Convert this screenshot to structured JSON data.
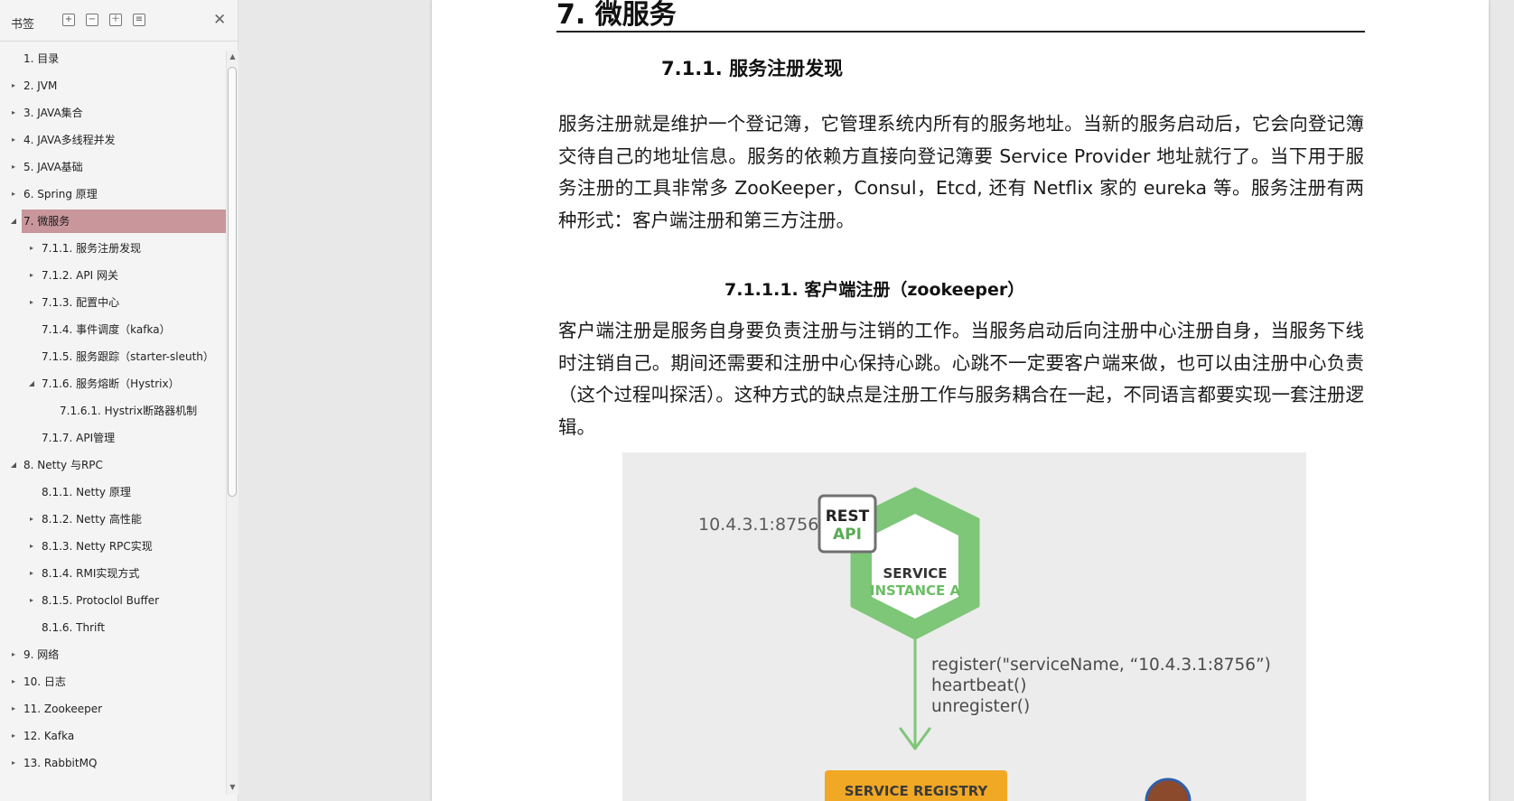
{
  "sidebar": {
    "title": "书签",
    "toolbar": {
      "expand_icon": "expand-all-icon",
      "collapse_icon": "collapse-all-icon",
      "add_icon": "add-bookmark-icon",
      "bookmark_icon": "bookmark-options-icon"
    },
    "close_label": "✕",
    "items": [
      {
        "label": "1. 目录",
        "level": 1,
        "expander": "none",
        "selected": false
      },
      {
        "label": "2. JVM",
        "level": 1,
        "expander": "collapsed",
        "selected": false
      },
      {
        "label": "3. JAVA集合",
        "level": 1,
        "expander": "collapsed",
        "selected": false
      },
      {
        "label": "4. JAVA多线程并发",
        "level": 1,
        "expander": "collapsed",
        "selected": false
      },
      {
        "label": "5. JAVA基础",
        "level": 1,
        "expander": "collapsed",
        "selected": false
      },
      {
        "label": "6. Spring 原理",
        "level": 1,
        "expander": "collapsed",
        "selected": false
      },
      {
        "label": "7.   微服务",
        "level": 1,
        "expander": "expanded",
        "selected": true
      },
      {
        "label": "7.1.1. 服务注册发现",
        "level": 2,
        "expander": "collapsed",
        "selected": false
      },
      {
        "label": "7.1.2. API 网关",
        "level": 2,
        "expander": "collapsed",
        "selected": false
      },
      {
        "label": "7.1.3. 配置中心",
        "level": 2,
        "expander": "collapsed",
        "selected": false
      },
      {
        "label": "7.1.4. 事件调度（kafka）",
        "level": 2,
        "expander": "none",
        "selected": false
      },
      {
        "label": "7.1.5. 服务跟踪（starter-sleuth）",
        "level": 2,
        "expander": "none",
        "selected": false
      },
      {
        "label": "7.1.6. 服务熔断（Hystrix）",
        "level": 2,
        "expander": "expanded",
        "selected": false
      },
      {
        "label": "7.1.6.1. Hystrix断路器机制",
        "level": 3,
        "expander": "none",
        "selected": false
      },
      {
        "label": "7.1.7. API管理",
        "level": 2,
        "expander": "none",
        "selected": false
      },
      {
        "label": "8. Netty 与RPC",
        "level": 1,
        "expander": "expanded",
        "selected": false
      },
      {
        "label": "8.1.1. Netty 原理",
        "level": 2,
        "expander": "none",
        "selected": false
      },
      {
        "label": "8.1.2. Netty 高性能",
        "level": 2,
        "expander": "collapsed",
        "selected": false
      },
      {
        "label": "8.1.3. Netty RPC实现",
        "level": 2,
        "expander": "collapsed",
        "selected": false
      },
      {
        "label": "8.1.4. RMI实现方式",
        "level": 2,
        "expander": "collapsed",
        "selected": false
      },
      {
        "label": "8.1.5. Protoclol Buffer",
        "level": 2,
        "expander": "collapsed",
        "selected": false
      },
      {
        "label": "8.1.6. Thrift",
        "level": 2,
        "expander": "none",
        "selected": false
      },
      {
        "label": "9. 网络",
        "level": 1,
        "expander": "collapsed",
        "selected": false
      },
      {
        "label": "10. 日志",
        "level": 1,
        "expander": "collapsed",
        "selected": false
      },
      {
        "label": "11. Zookeeper",
        "level": 1,
        "expander": "collapsed",
        "selected": false
      },
      {
        "label": "12. Kafka",
        "level": 1,
        "expander": "collapsed",
        "selected": false
      },
      {
        "label": "13. RabbitMQ",
        "level": 1,
        "expander": "collapsed",
        "selected": false
      }
    ]
  },
  "document": {
    "heading1": "7.   微服务",
    "heading2": "7.1.1.  服务注册发现",
    "paragraph1": " 服务注册就是维护一个登记簿，它管理系统内所有的服务地址。当新的服务启动后，它会向登记簿交待自己的地址信息。服务的依赖方直接向登记簿要 Service Provider 地址就行了。当下用于服务注册的工具非常多 ZooKeeper，Consul，Etcd, 还有 Netflix 家的 eureka 等。服务注册有两种形式：客户端注册和第三方注册。",
    "heading3": "7.1.1.1.      客户端注册（zookeeper）",
    "paragraph2": "客户端注册是服务自身要负责注册与注销的工作。当服务启动后向注册中心注册自身，当服务下线时注销自己。期间还需要和注册中心保持心跳。心跳不一定要客户端来做，也可以由注册中心负责（这个过程叫探活）。这种方式的缺点是注册工作与服务耦合在一起，不同语言都要实现一套注册逻辑。",
    "figure": {
      "ip_address": "10.4.3.1:8756",
      "rest_line1": "REST",
      "rest_line2": "API",
      "service_line1": "SERVICE",
      "service_line2": "INSTANCE A",
      "call_register": "register(\"serviceName, “10.4.3.1:8756”)",
      "call_heartbeat": "heartbeat()",
      "call_unregister": "unregister()",
      "registry_label": "SERVICE REGISTRY",
      "colors": {
        "green": "#7ec678",
        "dark_green": "#5aab56",
        "orange": "#f1a824",
        "background": "#ececec"
      }
    }
  }
}
